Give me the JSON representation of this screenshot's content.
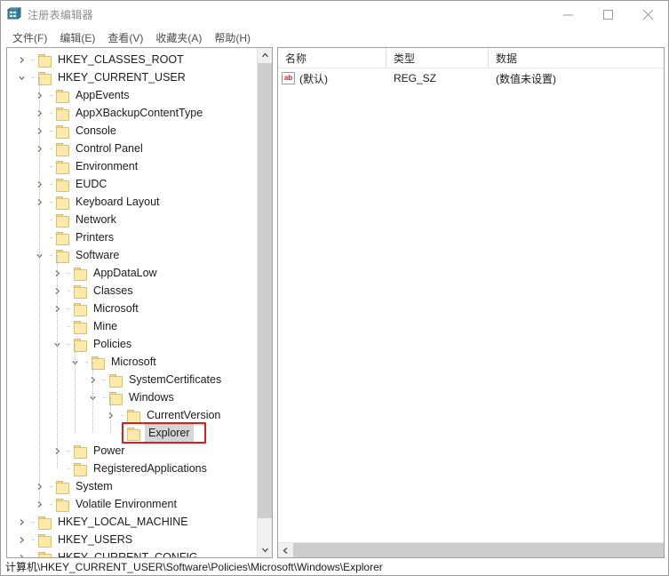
{
  "window": {
    "title": "注册表编辑器",
    "icon": "registry-editor-icon",
    "controls": {
      "minimize": "最小化",
      "maximize": "最大化",
      "close": "关闭"
    }
  },
  "menubar": {
    "items": [
      {
        "label": "文件(F)"
      },
      {
        "label": "编辑(E)"
      },
      {
        "label": "查看(V)"
      },
      {
        "label": "收藏夹(A)"
      },
      {
        "label": "帮助(H)"
      }
    ]
  },
  "tree": {
    "nodes": [
      {
        "label": "HKEY_CLASSES_ROOT",
        "depth": 0,
        "state": "collapsed",
        "selected": false
      },
      {
        "label": "HKEY_CURRENT_USER",
        "depth": 0,
        "state": "expanded",
        "selected": false
      },
      {
        "label": "AppEvents",
        "depth": 1,
        "state": "collapsed",
        "selected": false
      },
      {
        "label": "AppXBackupContentType",
        "depth": 1,
        "state": "collapsed",
        "selected": false
      },
      {
        "label": "Console",
        "depth": 1,
        "state": "collapsed",
        "selected": false
      },
      {
        "label": "Control Panel",
        "depth": 1,
        "state": "collapsed",
        "selected": false
      },
      {
        "label": "Environment",
        "depth": 1,
        "state": "leaf",
        "selected": false
      },
      {
        "label": "EUDC",
        "depth": 1,
        "state": "collapsed",
        "selected": false
      },
      {
        "label": "Keyboard Layout",
        "depth": 1,
        "state": "collapsed",
        "selected": false
      },
      {
        "label": "Network",
        "depth": 1,
        "state": "leaf",
        "selected": false
      },
      {
        "label": "Printers",
        "depth": 1,
        "state": "leaf",
        "selected": false
      },
      {
        "label": "Software",
        "depth": 1,
        "state": "expanded",
        "selected": false
      },
      {
        "label": "AppDataLow",
        "depth": 2,
        "state": "collapsed",
        "selected": false
      },
      {
        "label": "Classes",
        "depth": 2,
        "state": "collapsed",
        "selected": false
      },
      {
        "label": "Microsoft",
        "depth": 2,
        "state": "collapsed",
        "selected": false
      },
      {
        "label": "Mine",
        "depth": 2,
        "state": "leaf",
        "selected": false
      },
      {
        "label": "Policies",
        "depth": 2,
        "state": "expanded",
        "selected": false
      },
      {
        "label": "Microsoft",
        "depth": 3,
        "state": "expanded",
        "selected": false
      },
      {
        "label": "SystemCertificates",
        "depth": 4,
        "state": "collapsed",
        "selected": false
      },
      {
        "label": "Windows",
        "depth": 4,
        "state": "expanded",
        "selected": false
      },
      {
        "label": "CurrentVersion",
        "depth": 5,
        "state": "collapsed",
        "selected": false
      },
      {
        "label": "Explorer",
        "depth": 5,
        "state": "leaf",
        "selected": true
      },
      {
        "label": "Power",
        "depth": 2,
        "state": "collapsed",
        "selected": false
      },
      {
        "label": "RegisteredApplications",
        "depth": 2,
        "state": "leaf",
        "selected": false
      },
      {
        "label": "System",
        "depth": 1,
        "state": "collapsed",
        "selected": false
      },
      {
        "label": "Volatile Environment",
        "depth": 1,
        "state": "collapsed",
        "selected": false
      },
      {
        "label": "HKEY_LOCAL_MACHINE",
        "depth": 0,
        "state": "collapsed",
        "selected": false
      },
      {
        "label": "HKEY_USERS",
        "depth": 0,
        "state": "collapsed",
        "selected": false
      },
      {
        "label": "HKEY_CURRENT_CONFIG",
        "depth": 0,
        "state": "collapsed",
        "selected": false
      }
    ],
    "highlight": {
      "target_label": "Explorer",
      "color": "#e01b1b"
    }
  },
  "list": {
    "columns": [
      {
        "key": "name",
        "label": "名称"
      },
      {
        "key": "type",
        "label": "类型"
      },
      {
        "key": "data",
        "label": "数据"
      }
    ],
    "rows": [
      {
        "icon": "string-value-icon",
        "name": "(默认)",
        "type": "REG_SZ",
        "data": "(数值未设置)"
      }
    ]
  },
  "statusbar": {
    "path": "计算机\\HKEY_CURRENT_USER\\Software\\Policies\\Microsoft\\Windows\\Explorer"
  },
  "colors": {
    "folder_fill": "#fde9a9",
    "folder_border": "#e6c24d",
    "selection": "#d6d6d6",
    "annotation": "#e01b1b",
    "scrollbar_thumb": "#cdcdcd"
  }
}
